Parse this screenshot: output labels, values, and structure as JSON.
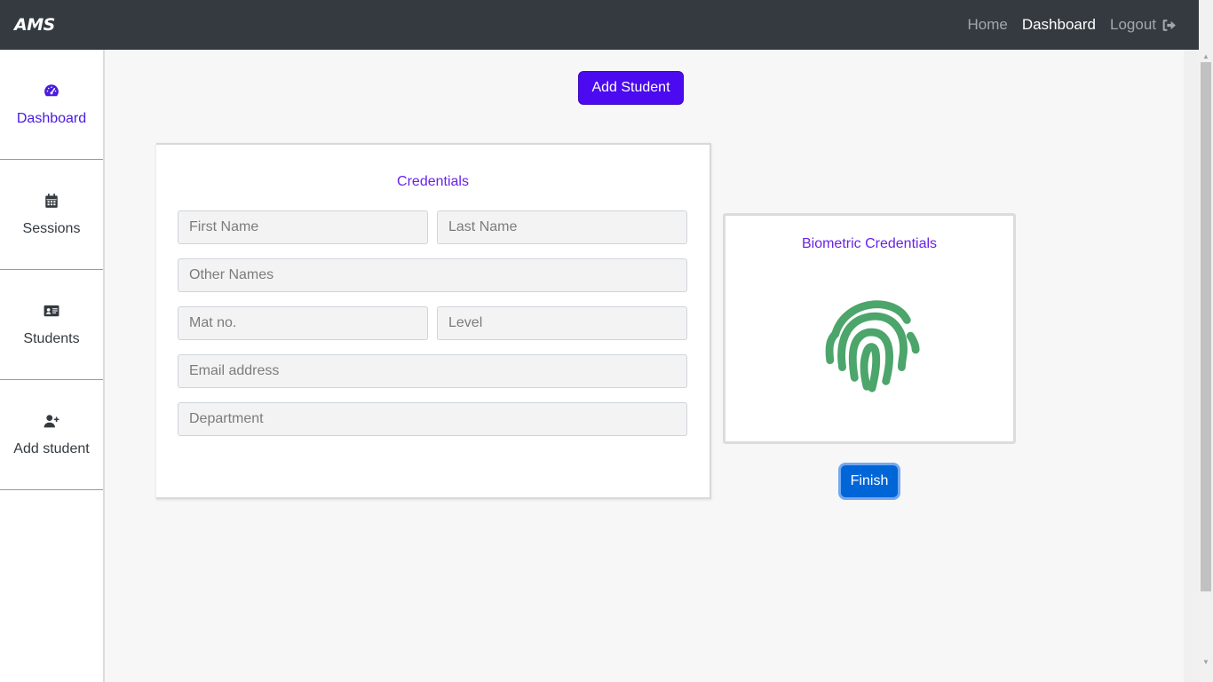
{
  "navbar": {
    "brand": "AMS",
    "links": [
      {
        "label": "Home"
      },
      {
        "label": "Dashboard"
      },
      {
        "label": "Logout"
      }
    ]
  },
  "sidebar": {
    "items": [
      {
        "label": "Dashboard",
        "icon": "tachometer-icon"
      },
      {
        "label": "Sessions",
        "icon": "calendar-icon"
      },
      {
        "label": "Students",
        "icon": "id-card-icon"
      },
      {
        "label": "Add student",
        "icon": "user-plus-icon"
      }
    ]
  },
  "main": {
    "add_button": "Add Student",
    "credentials": {
      "title": "Credentials",
      "fields": {
        "first_name": "First Name",
        "last_name": "Last Name",
        "other_names": "Other Names",
        "mat_no": "Mat no.",
        "level": "Level",
        "email": "Email address",
        "department": "Department"
      }
    },
    "biometric": {
      "title": "Biometric Credentials",
      "icon": "fingerprint-icon"
    },
    "finish_button": "Finish"
  },
  "colors": {
    "navbar_bg": "#343a40",
    "accent_purple": "#4b0aef",
    "title_purple": "#6a22e8",
    "finish_blue": "#0066d8",
    "fingerprint_green": "#4caf6e"
  }
}
